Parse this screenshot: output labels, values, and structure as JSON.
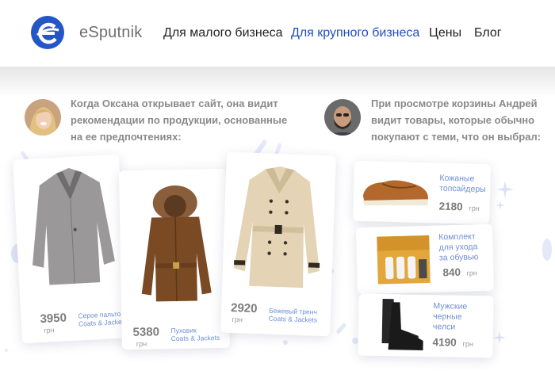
{
  "header": {
    "logo_text": "eSputnik",
    "nav": [
      {
        "label": "Для малого бизнеса"
      },
      {
        "label": "Для крупного бизнеса"
      },
      {
        "label": "Цены"
      },
      {
        "label": "Блог"
      }
    ],
    "active_nav": "Для крупного бизнеса",
    "accent_color": "#1f4fbf"
  },
  "personas": [
    {
      "text_lines": [
        "Когда Оксана открывает сайт, она видит",
        "рекомендации по продукции, основанные",
        "на ее предпочтениях:"
      ]
    },
    {
      "text_lines": [
        "При просмотре корзины Андрей",
        "видит товары, которые обычно",
        "покупают с теми, что он выбрал:"
      ]
    }
  ],
  "products": [
    {
      "price": "3950",
      "currency": "грн",
      "name": "Серое пальто",
      "brand": "Coats & Jackets"
    },
    {
      "price": "5380",
      "currency": "грн",
      "name": "Пуховик",
      "brand": "Coats & Jackets"
    },
    {
      "price": "2920",
      "currency": "грн",
      "name": "Бежевый тренч",
      "brand": "Coats & Jackets"
    }
  ],
  "related": [
    {
      "name_lines": [
        "Кожаные",
        "топсайдеры"
      ],
      "price": "2180",
      "currency": "грн"
    },
    {
      "name_lines": [
        "Комплект",
        "для ухода",
        "за обувью"
      ],
      "price": "840",
      "currency": "грн"
    },
    {
      "name_lines": [
        "Мужские",
        "черные",
        "челси"
      ],
      "price": "4190",
      "currency": "грн"
    }
  ],
  "icons": [
    "esputnik-logo-icon",
    "sparkle-icon"
  ]
}
